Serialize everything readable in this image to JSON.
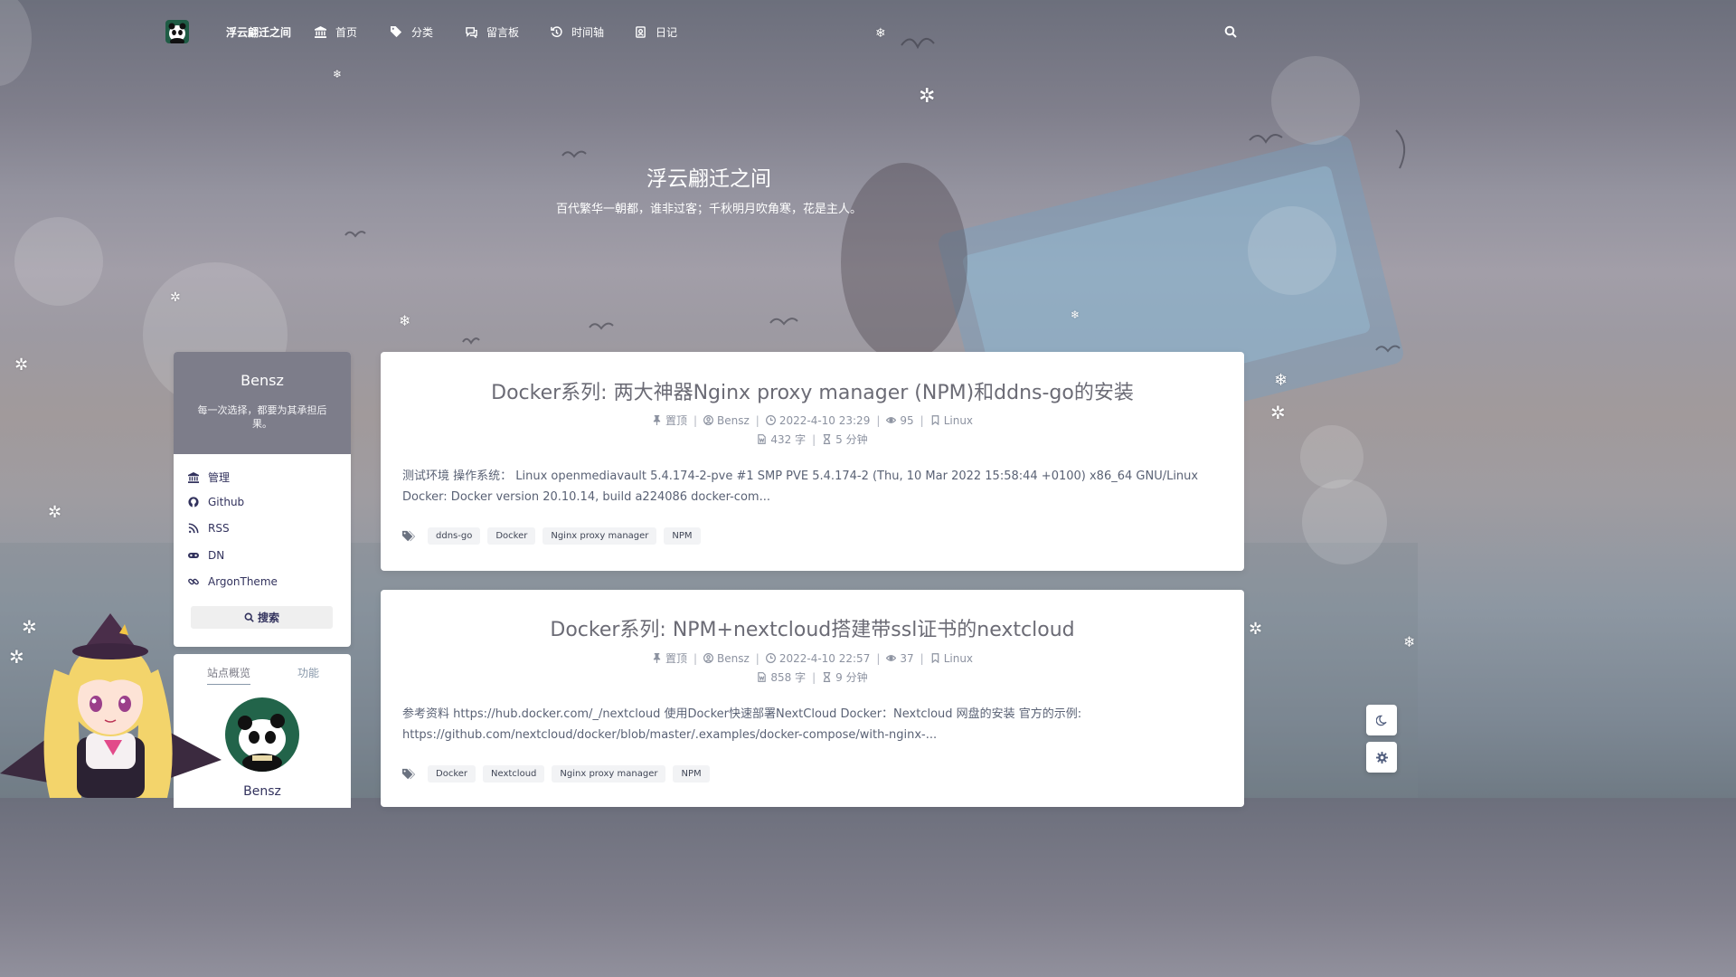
{
  "nav": {
    "brand": "浮云翩迁之间",
    "items": [
      {
        "label": "首页",
        "icon": "bank-icon"
      },
      {
        "label": "分类",
        "icon": "tags-icon"
      },
      {
        "label": "留言板",
        "icon": "comments-icon"
      },
      {
        "label": "时间轴",
        "icon": "history-icon"
      },
      {
        "label": "日记",
        "icon": "diary-icon"
      }
    ],
    "search_icon": "search-icon"
  },
  "banner": {
    "title": "浮云翩迁之间",
    "subtitle": "百代繁华一朝都，谁非过客；千秋明月吹角寒，花是主人。"
  },
  "sidebar": {
    "profile": {
      "name": "Bensz",
      "motto": "每一次选择，都要为其承担后果。"
    },
    "links": [
      {
        "label": "管理",
        "icon": "bank-icon"
      },
      {
        "label": "Github",
        "icon": "github-icon"
      },
      {
        "label": "RSS",
        "icon": "rss-icon"
      },
      {
        "label": "DN",
        "icon": "gamepad-icon"
      },
      {
        "label": "ArgonTheme",
        "icon": "link-icon"
      }
    ],
    "search_button": "搜索",
    "overview": {
      "tabs": [
        "站点概览",
        "功能"
      ],
      "name": "Bensz"
    }
  },
  "posts": [
    {
      "title": "Docker系列: 两大神器Nginx proxy manager (NPM)和ddns-go的安装",
      "pinned": "置顶",
      "author": "Bensz",
      "date": "2022-4-10 23:29",
      "views": "95",
      "category": "Linux",
      "words": "432 字",
      "read_time": "5 分钟",
      "excerpt": "测试环境 操作系统： Linux openmediavault 5.4.174-2-pve #1 SMP PVE 5.4.174-2 (Thu, 10 Mar 2022 15:58:44 +0100) x86_64 GNU/Linux Docker: Docker version 20.10.14, build a224086 docker-com...",
      "tags": [
        "ddns-go",
        "Docker",
        "Nginx proxy manager",
        "NPM"
      ]
    },
    {
      "title": "Docker系列: NPM+nextcloud搭建带ssl证书的nextcloud",
      "pinned": "置顶",
      "author": "Bensz",
      "date": "2022-4-10 22:57",
      "views": "37",
      "category": "Linux",
      "words": "858 字",
      "read_time": "9 分钟",
      "excerpt": "参考资料 https://hub.docker.com/_/nextcloud 使用Docker快速部署NextCloud Docker：Nextcloud 网盘的安装 官方的示例: https://github.com/nextcloud/docker/blob/master/.examples/docker-compose/with-nginx-...",
      "tags": [
        "Docker",
        "Nextcloud",
        "Nginx proxy manager",
        "NPM"
      ]
    }
  ],
  "floating": {
    "dark_mode_icon": "moon-icon",
    "settings_icon": "gear-icon"
  },
  "colors": {
    "accent": "#5e72e4",
    "tag_bg": "#f2f3f5",
    "profile_header": "#606070"
  }
}
